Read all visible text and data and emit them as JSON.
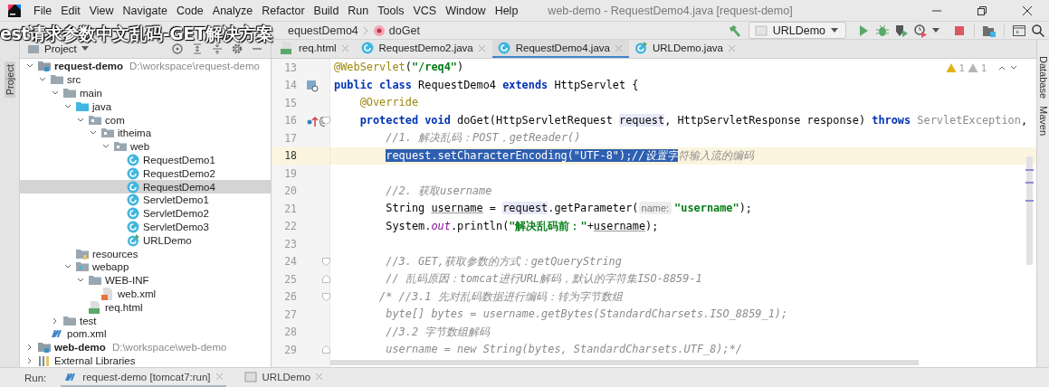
{
  "window": {
    "title": "web-demo - RequestDemo4.java [request-demo]"
  },
  "menu": [
    "File",
    "Edit",
    "View",
    "Navigate",
    "Code",
    "Analyze",
    "Refactor",
    "Build",
    "Run",
    "Tools",
    "VCS",
    "Window",
    "Help"
  ],
  "caption": "est请求参数中文乱码-GET解决方案",
  "breadcrumbs": [
    {
      "label": "equestDemo4",
      "kind": "class"
    },
    {
      "label": "doGet",
      "kind": "method"
    }
  ],
  "run_config": {
    "label": "URLDemo"
  },
  "left_tools": [
    "Project"
  ],
  "right_tools": [
    "Database",
    "Maven"
  ],
  "project_panel": {
    "title": "Project",
    "tree": [
      {
        "label": "request-demo",
        "path": "D:\\workspace\\request-demo",
        "kind": "module",
        "expanded": true,
        "selected": false,
        "children": [
          {
            "label": "src",
            "kind": "folder",
            "expanded": true,
            "selected": false,
            "children": [
              {
                "label": "main",
                "kind": "folder",
                "expanded": true,
                "selected": false,
                "children": [
                  {
                    "label": "java",
                    "kind": "source",
                    "expanded": true,
                    "selected": false,
                    "children": [
                      {
                        "label": "com",
                        "kind": "package",
                        "expanded": true,
                        "selected": false,
                        "children": [
                          {
                            "label": "itheima",
                            "kind": "package",
                            "expanded": true,
                            "selected": false,
                            "children": [
                              {
                                "label": "web",
                                "kind": "package",
                                "expanded": true,
                                "selected": false,
                                "children": [
                                  {
                                    "label": "RequestDemo1",
                                    "kind": "class",
                                    "selected": false
                                  },
                                  {
                                    "label": "RequestDemo2",
                                    "kind": "class",
                                    "selected": false
                                  },
                                  {
                                    "label": "RequestDemo4",
                                    "kind": "class",
                                    "selected": true
                                  },
                                  {
                                    "label": "ServletDemo1",
                                    "kind": "class",
                                    "selected": false
                                  },
                                  {
                                    "label": "ServletDemo2",
                                    "kind": "class",
                                    "selected": false
                                  },
                                  {
                                    "label": "ServletDemo3",
                                    "kind": "class",
                                    "selected": false
                                  },
                                  {
                                    "label": "URLDemo",
                                    "kind": "main-class",
                                    "selected": false
                                  }
                                ]
                              }
                            ]
                          }
                        ]
                      }
                    ]
                  },
                  {
                    "label": "resources",
                    "kind": "resources",
                    "selected": false
                  },
                  {
                    "label": "webapp",
                    "kind": "web",
                    "expanded": true,
                    "selected": false,
                    "children": [
                      {
                        "label": "WEB-INF",
                        "kind": "folder",
                        "expanded": true,
                        "selected": false,
                        "children": [
                          {
                            "label": "web.xml",
                            "kind": "xml",
                            "selected": false
                          }
                        ]
                      },
                      {
                        "label": "req.html",
                        "kind": "html",
                        "selected": false
                      }
                    ]
                  }
                ]
              },
              {
                "label": "test",
                "kind": "folder",
                "expanded": false,
                "selected": false
              }
            ]
          },
          {
            "label": "pom.xml",
            "kind": "maven",
            "selected": false
          }
        ]
      },
      {
        "label": "web-demo",
        "path": "D:\\workspace\\web-demo",
        "kind": "module",
        "expanded": false,
        "selected": false
      },
      {
        "label": "External Libraries",
        "kind": "library",
        "expanded": false,
        "selected": false
      }
    ]
  },
  "editor_tabs": [
    {
      "label": "req.html",
      "kind": "html",
      "selected": false
    },
    {
      "label": "RequestDemo2.java",
      "kind": "class",
      "selected": false
    },
    {
      "label": "RequestDemo4.java",
      "kind": "class",
      "selected": true
    },
    {
      "label": "URLDemo.java",
      "kind": "main-class",
      "selected": false
    }
  ],
  "inspections": {
    "warnings": "1",
    "weak_warnings": "1"
  },
  "code_lines": [
    {
      "number": "13",
      "current": false,
      "tokens": [
        {
          "text": "@WebServlet",
          "kind": "annotation"
        },
        {
          "text": "(",
          "kind": "plain"
        },
        {
          "text": "\"/req4\"",
          "kind": "string"
        },
        {
          "text": ")",
          "kind": "plain"
        }
      ]
    },
    {
      "number": "14",
      "current": false,
      "gutter": {
        "kind": "servlet"
      },
      "tokens": [
        {
          "text": "public class",
          "kind": "keyword"
        },
        {
          "text": " RequestDemo4 ",
          "kind": "plain"
        },
        {
          "text": "extends",
          "kind": "keyword"
        },
        {
          "text": " HttpServlet {",
          "kind": "plain"
        }
      ]
    },
    {
      "number": "15",
      "current": false,
      "scope": {
        "kind": "class"
      },
      "tokens": [
        {
          "text": "@Override",
          "kind": "annotation"
        }
      ]
    },
    {
      "number": "16",
      "current": false,
      "gutter": {
        "kind": "override"
      },
      "gutter_mark": "@",
      "fold": {
        "kind": "start"
      },
      "scope": {
        "kind": "class"
      },
      "tokens": [
        {
          "text": "protected void",
          "kind": "keyword"
        },
        {
          "text": " doGet(HttpServletRequest ",
          "kind": "plain"
        },
        {
          "text": "request",
          "kind": "reference"
        },
        {
          "text": ", HttpServletResponse response) ",
          "kind": "plain"
        },
        {
          "text": "throws",
          "kind": "keyword"
        },
        {
          "text": " ServletException",
          "kind": "unused"
        },
        {
          "text": ",",
          "kind": "plain"
        }
      ]
    },
    {
      "number": "17",
      "current": false,
      "scope": {
        "kind": "method"
      },
      "tokens": [
        {
          "text": "//1. 解决乱码：POST，getReader()",
          "kind": "comment"
        }
      ]
    },
    {
      "number": "18",
      "current": true,
      "scope": {
        "kind": "method"
      },
      "tokens": [
        {
          "text": "request.setCharacterEncoding(\"UTF-8\");",
          "kind": "selected"
        },
        {
          "text": "//设置字",
          "kind": "selected-comment"
        },
        {
          "text": "符输入流的编码",
          "kind": "comment"
        }
      ]
    },
    {
      "number": "19",
      "current": false
    },
    {
      "number": "20",
      "current": false,
      "scope": {
        "kind": "method"
      },
      "tokens": [
        {
          "text": "//2. 获取username",
          "kind": "comment"
        }
      ]
    },
    {
      "number": "21",
      "current": false,
      "scope": {
        "kind": "method"
      },
      "tokens": [
        {
          "text": "String ",
          "kind": "plain"
        },
        {
          "text": "username",
          "kind": "reassigned"
        },
        {
          "text": " = ",
          "kind": "plain"
        },
        {
          "text": "request",
          "kind": "reference"
        },
        {
          "text": ".getParameter(",
          "kind": "plain"
        },
        {
          "text": "name:",
          "kind": "hint"
        },
        {
          "text": "\"username\"",
          "kind": "string"
        },
        {
          "text": ");",
          "kind": "plain"
        }
      ]
    },
    {
      "number": "22",
      "current": false,
      "scope": {
        "kind": "method"
      },
      "tokens": [
        {
          "text": "System.",
          "kind": "plain"
        },
        {
          "text": "out",
          "kind": "static"
        },
        {
          "text": ".println(",
          "kind": "plain"
        },
        {
          "text": "\"解决乱码前：\"",
          "kind": "string"
        },
        {
          "text": "+",
          "kind": "plain"
        },
        {
          "text": "username",
          "kind": "reassigned"
        },
        {
          "text": ");",
          "kind": "plain"
        }
      ]
    },
    {
      "number": "23",
      "current": false
    },
    {
      "number": "24",
      "current": false,
      "fold": {
        "kind": "start"
      },
      "scope": {
        "kind": "method"
      },
      "tokens": [
        {
          "text": "//3. GET,获取参数的方式：getQueryString",
          "kind": "comment"
        }
      ]
    },
    {
      "number": "25",
      "current": false,
      "fold": {
        "kind": "end"
      },
      "scope": {
        "kind": "method"
      },
      "tokens": [
        {
          "text": "// 乱码原因：tomcat进行URL解码，默认的字符集ISO-8859-1",
          "kind": "comment"
        }
      ]
    },
    {
      "number": "26",
      "current": false,
      "fold": {
        "kind": "start"
      },
      "scope": {
        "kind": "block-comment-open"
      },
      "tokens": [
        {
          "text": "/* //3.1 先对乱码数据进行编码：转为字节数组",
          "kind": "comment"
        }
      ]
    },
    {
      "number": "27",
      "current": false,
      "scope": {
        "kind": "method"
      },
      "tokens": [
        {
          "text": "byte[] bytes = username.getBytes(StandardCharsets.ISO_8859_1);",
          "kind": "comment"
        }
      ]
    },
    {
      "number": "28",
      "current": false,
      "scope": {
        "kind": "method"
      },
      "tokens": [
        {
          "text": "//3.2 字节数组解码",
          "kind": "comment"
        }
      ]
    },
    {
      "number": "29",
      "current": false,
      "fold": {
        "kind": "end"
      },
      "scope": {
        "kind": "method"
      },
      "tokens": [
        {
          "text": "username = new String(bytes, StandardCharsets.UTF_8);*/",
          "kind": "comment"
        }
      ]
    }
  ],
  "run_bar": {
    "label": "Run:",
    "tabs": [
      {
        "label": "request-demo [tomcat7:run]",
        "kind": "maven",
        "selected": true
      },
      {
        "label": "URLDemo",
        "kind": "app",
        "selected": false
      }
    ]
  }
}
